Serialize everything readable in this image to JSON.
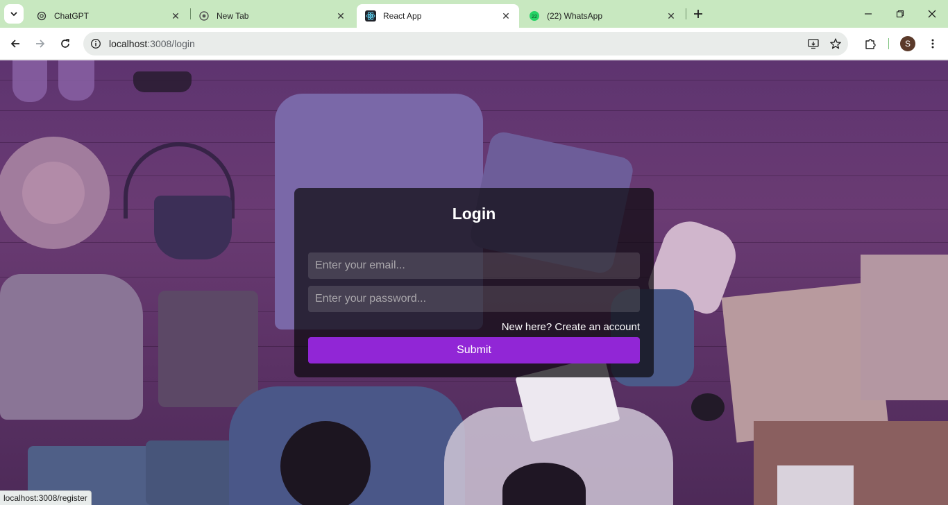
{
  "browser": {
    "tabs": [
      {
        "title": "ChatGPT",
        "icon": "chatgpt-icon"
      },
      {
        "title": "New Tab",
        "icon": "chrome-icon"
      },
      {
        "title": "React App",
        "icon": "react-icon",
        "active": true
      },
      {
        "title": "(22) WhatsApp",
        "icon": "whatsapp-icon",
        "badge": "22"
      }
    ],
    "address_bar": {
      "host": "localhost",
      "path": ":3008/login"
    },
    "profile_initial": "S",
    "status_url": "localhost:3008/register"
  },
  "login": {
    "title": "Login",
    "email_placeholder": "Enter your email...",
    "password_placeholder": "Enter your password...",
    "create_account_link": "New here? Create an account",
    "submit_label": "Submit"
  },
  "colors": {
    "tab_strip": "#c8e8c0",
    "accent_button": "#9126d6",
    "overlay": "#5e3470"
  }
}
